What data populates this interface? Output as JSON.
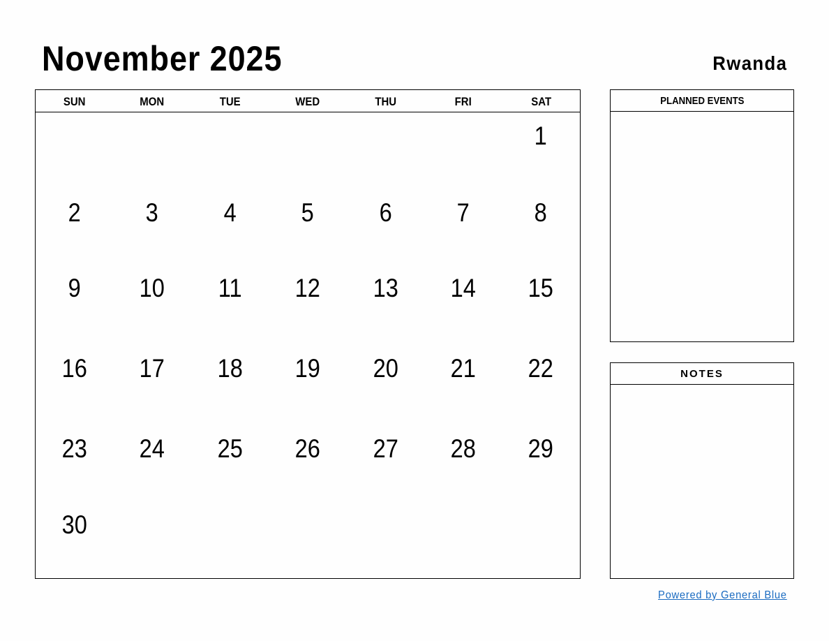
{
  "header": {
    "title": "November 2025",
    "country": "Rwanda"
  },
  "calendar": {
    "weekdays": [
      "SUN",
      "MON",
      "TUE",
      "WED",
      "THU",
      "FRI",
      "SAT"
    ],
    "weeks": [
      [
        "",
        "",
        "",
        "",
        "",
        "",
        "1"
      ],
      [
        "2",
        "3",
        "4",
        "5",
        "6",
        "7",
        "8"
      ],
      [
        "9",
        "10",
        "11",
        "12",
        "13",
        "14",
        "15"
      ],
      [
        "16",
        "17",
        "18",
        "19",
        "20",
        "21",
        "22"
      ],
      [
        "23",
        "24",
        "25",
        "26",
        "27",
        "28",
        "29"
      ],
      [
        "30",
        "",
        "",
        "",
        "",
        "",
        ""
      ]
    ]
  },
  "panels": {
    "planned_events": "PLANNED EVENTS",
    "notes": "NOTES"
  },
  "footer": {
    "link": "Powered by General Blue",
    "link_color": "#1a6bc1"
  }
}
